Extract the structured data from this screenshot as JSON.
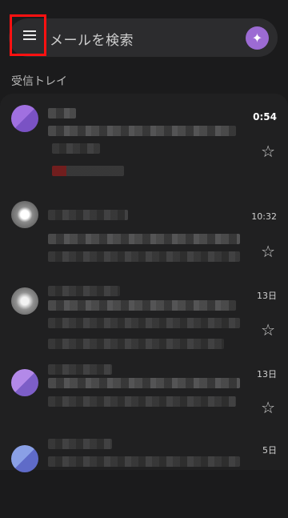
{
  "search": {
    "placeholder": "メールを検索"
  },
  "section": {
    "title": "受信トレイ"
  },
  "colors": {
    "accent_avatar": "#9c6bd3",
    "highlight": "#ff1111"
  },
  "icons": {
    "menu": "hamburger-icon",
    "star": "star-outline-icon",
    "profile": "profile-avatar"
  },
  "emails": [
    {
      "time": "0:54",
      "star": "☆"
    },
    {
      "time": "10:32",
      "star": "☆"
    },
    {
      "time": "13日",
      "star": "☆"
    },
    {
      "time": "13日",
      "star": "☆"
    },
    {
      "time": "5日",
      "star": ""
    }
  ]
}
